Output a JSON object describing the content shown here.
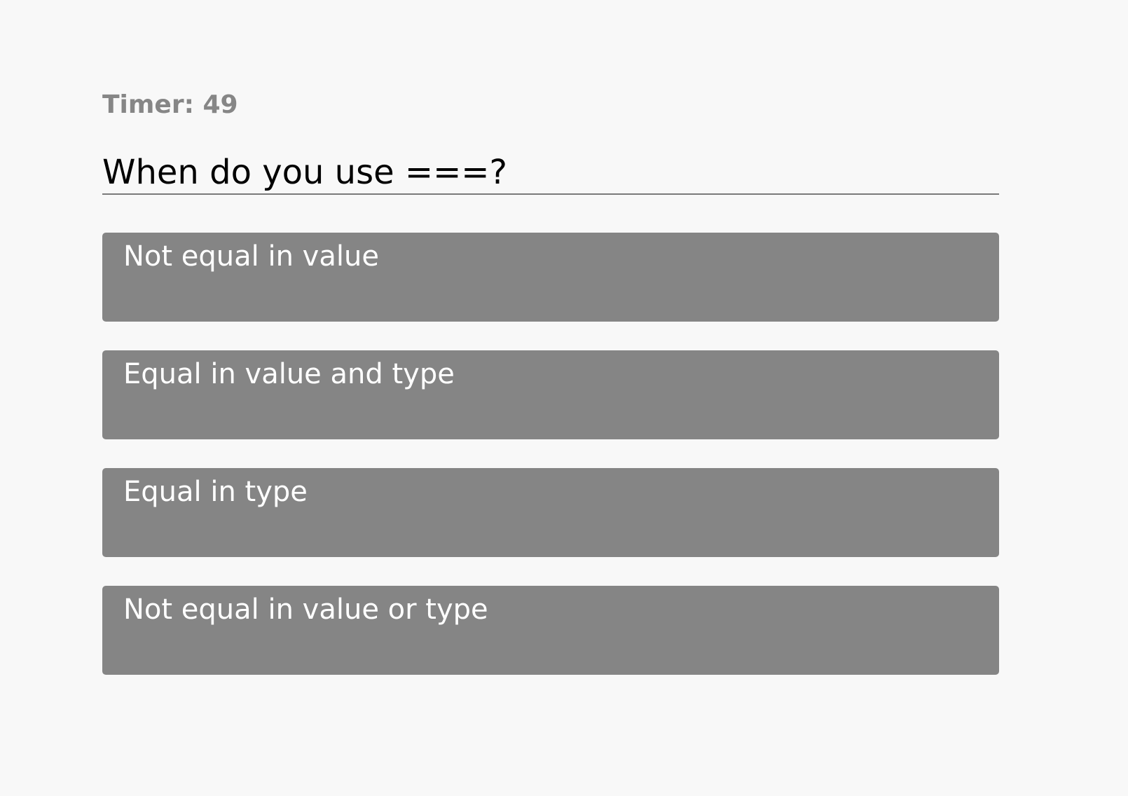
{
  "timer": {
    "text": "Timer: 49"
  },
  "question": {
    "text": "When do you use ===?"
  },
  "answers": [
    {
      "label": "Not equal in value"
    },
    {
      "label": "Equal in value and type"
    },
    {
      "label": "Equal in type"
    },
    {
      "label": "Not equal in value or type"
    }
  ],
  "colors": {
    "background": "#f8f8f8",
    "timer_text": "#868686",
    "question_text": "#000000",
    "question_underline": "#7a7a7a",
    "answer_background": "#858585",
    "answer_text": "#ffffff"
  }
}
